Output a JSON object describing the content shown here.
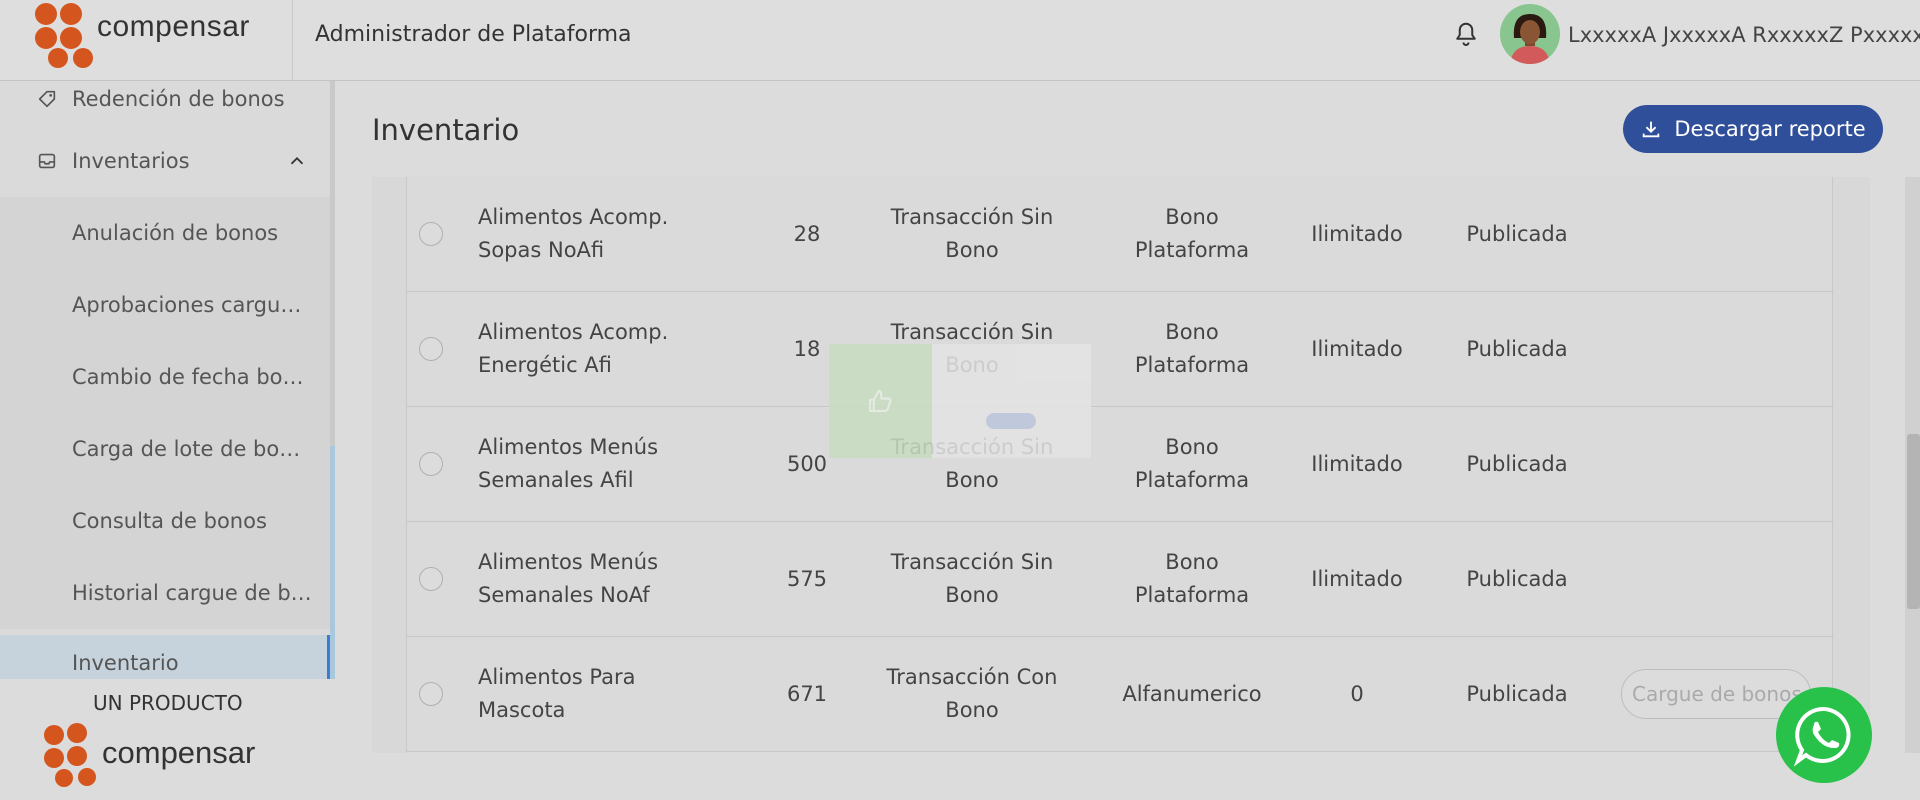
{
  "header": {
    "brand": "compensar",
    "title": "Administrador de Plataforma",
    "user_name": "LxxxxxA JxxxxxA RxxxxxZ PxxxxxA"
  },
  "sidebar": {
    "items": [
      {
        "label": "Redención de bonos",
        "icon": "tag-icon"
      },
      {
        "label": "Inventarios",
        "icon": "inbox-icon",
        "expanded": true
      },
      {
        "label": "Anulación de bonos"
      },
      {
        "label": "Aprobaciones cargue ..."
      },
      {
        "label": "Cambio de fecha bonos"
      },
      {
        "label": "Carga de lote de bonos"
      },
      {
        "label": "Consulta de bonos"
      },
      {
        "label": "Historial cargue de bo..."
      },
      {
        "label": "Inventario",
        "active": true
      }
    ],
    "product_label": "UN PRODUCTO",
    "product_brand": "compensar"
  },
  "main": {
    "title": "Inventario",
    "download_label": "Descargar reporte",
    "rows": [
      {
        "name": "Alimentos Acomp. Sopas NoAfi",
        "qty": "28",
        "type": "Transacción Sin Bono",
        "bono": "Bono Plataforma",
        "limit": "Ilimitado",
        "state": "Publicada"
      },
      {
        "name": "Alimentos Acomp. Energétic Afi",
        "qty": "18",
        "type": "Transacción Sin Bono",
        "bono": "Bono Plataforma",
        "limit": "Ilimitado",
        "state": "Publicada"
      },
      {
        "name": "Alimentos Menús Semanales Afil",
        "qty": "500",
        "type": "Transacción Sin Bono",
        "bono": "Bono Plataforma",
        "limit": "Ilimitado",
        "state": "Publicada"
      },
      {
        "name": "Alimentos Menús Semanales NoAf",
        "qty": "575",
        "type": "Transacción Sin Bono",
        "bono": "Bono Plataforma",
        "limit": "Ilimitado",
        "state": "Publicada"
      },
      {
        "name": "Alimentos Para Mascota",
        "qty": "671",
        "type": "Transacción Con Bono",
        "bono": "Alfanumerico",
        "limit": "0",
        "state": "Publicada",
        "action": "Cargue de bonos"
      }
    ]
  },
  "colors": {
    "brand_orange": "#d4561e",
    "primary_blue": "#2f4f9b",
    "whatsapp_green": "#28c14a"
  }
}
